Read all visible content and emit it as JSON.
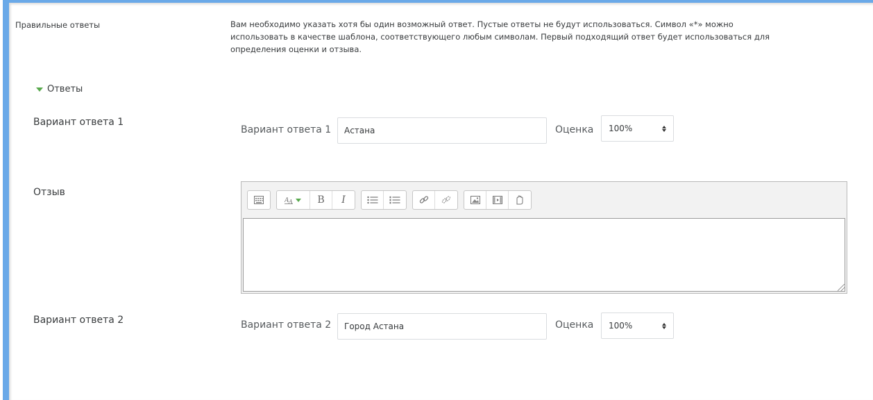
{
  "correct_answers": {
    "label": "Правильные ответы",
    "help_line1": "Вам необходимо указать хотя бы один возможный ответ. Пустые ответы не будут использоваться. Символ «*» можно",
    "help_line2": "использовать в качестве шаблона, соответствующего любым символам. Первый подходящий ответ будет использоваться для",
    "help_line3": "определения оценки и отзыва."
  },
  "answers_section": {
    "title": "Ответы",
    "expanded": true,
    "toggle_color": "#58a94d"
  },
  "answer1": {
    "row_label": "Вариант ответа 1",
    "field_label": "Вариант ответа 1",
    "value": "Астана",
    "grade_label": "Оценка",
    "grade_value": "100%"
  },
  "feedback": {
    "label": "Отзыв",
    "toolbar_icons": [
      "show-more-icon",
      "paragraph-style-icon",
      "bold-icon",
      "italic-icon",
      "bullet-list-icon",
      "numbered-list-icon",
      "link-icon",
      "unlink-icon",
      "image-icon",
      "media-icon",
      "manage-files-icon"
    ],
    "bold_glyph": "B",
    "italic_glyph": "I",
    "content": ""
  },
  "answer2": {
    "row_label": "Вариант ответа 2",
    "field_label": "Вариант ответа 2",
    "value": "Город Астана",
    "grade_label": "Оценка",
    "grade_value": "100%"
  },
  "colors": {
    "frame_accent": "#6aa9e8"
  }
}
